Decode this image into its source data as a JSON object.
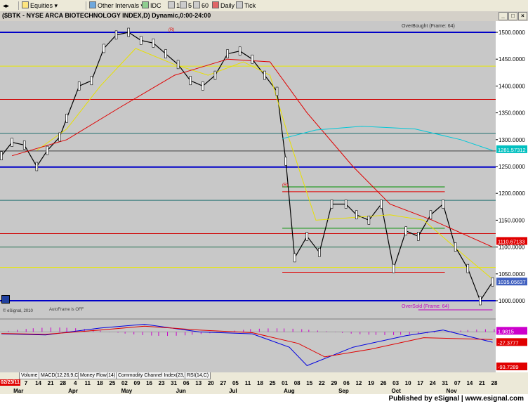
{
  "toolbar": {
    "items": [
      {
        "label": "Equities",
        "icon": "folder-icon"
      },
      {
        "label": "Other Intervals",
        "icon": "clock-icon"
      },
      {
        "label": "IDC",
        "icon": "chart-icon"
      },
      {
        "label": "1",
        "icon": ""
      },
      {
        "label": "5",
        "icon": ""
      },
      {
        "label": "60",
        "icon": ""
      },
      {
        "label": "Daily",
        "icon": "calendar-icon"
      },
      {
        "label": "Tick",
        "icon": "tick-icon"
      }
    ]
  },
  "window": {
    "title": "($BTK - NYSE ARCA BIOTECHNOLOGY INDEX,D) Dynamic,0:00-24:00",
    "minimize": "_",
    "maximize": "□",
    "close": "×"
  },
  "chart_labels": {
    "overbought": "OverBought (Frame: 64)",
    "oversold": "OverSold (Frame: 64)",
    "copyright": "© eSignal, 2010",
    "autoframe": "AutoFrame is OFF",
    "marker_r": "(R)"
  },
  "price_axis": {
    "ticks": [
      "1500.0000",
      "1450.0000",
      "1400.0000",
      "1350.0000",
      "1300.0000",
      "1250.0000",
      "1200.0000",
      "1150.0000",
      "1100.0000",
      "1050.0000",
      "1000.0000"
    ],
    "badges": [
      {
        "value": "1281.57312",
        "color": "#00c0c0"
      },
      {
        "value": "1110.67133",
        "color": "#e00000"
      },
      {
        "value": "1035.05637",
        "color": "#4060c0"
      }
    ]
  },
  "indicator_axis": {
    "badges": [
      {
        "value": "1.9815",
        "color": "#cc00cc"
      },
      {
        "value": "-27.3777",
        "color": "#e00000"
      },
      {
        "value": "-93.7289",
        "color": "#e00000"
      }
    ]
  },
  "tabs": [
    "Volume",
    "MACD(12,26,9,C)",
    "Money Flow(14)",
    "Commodity Channel Index(23,C)",
    "RSI(14,C)"
  ],
  "date_axis": {
    "first_label": "02/23/11",
    "days": [
      "7",
      "14",
      "21",
      "28",
      "4",
      "11",
      "18",
      "25",
      "02",
      "09",
      "16",
      "23",
      "31",
      "06",
      "13",
      "20",
      "27",
      "05",
      "11",
      "18",
      "25",
      "01",
      "08",
      "15",
      "22",
      "29",
      "06",
      "12",
      "19",
      "26",
      "03",
      "10",
      "17",
      "24",
      "31",
      "07",
      "14",
      "21",
      "28"
    ],
    "months": [
      "Mar",
      "Apr",
      "May",
      "Jun",
      "Jul",
      "Aug",
      "Sep",
      "Oct",
      "Nov"
    ]
  },
  "footer": {
    "text": "Published by eSignal | www.esignal.com"
  },
  "chart_data": {
    "type": "line",
    "title": "$BTK - NYSE ARCA BIOTECHNOLOGY INDEX, Daily",
    "ylim": [
      980,
      1520
    ],
    "x_range": [
      "2011-02-23",
      "2011-11-29"
    ],
    "grid": false,
    "horizontal_levels": [
      {
        "value": 1500,
        "color": "#0000c8"
      },
      {
        "value": 1437,
        "color": "#e8e800"
      },
      {
        "value": 1375,
        "color": "#d00000"
      },
      {
        "value": 1312,
        "color": "#207070"
      },
      {
        "value": 1279,
        "color": "#404040"
      },
      {
        "value": 1249,
        "color": "#0000c8"
      },
      {
        "value": 1187,
        "color": "#207070"
      },
      {
        "value": 1125,
        "color": "#d00000"
      },
      {
        "value": 1100,
        "color": "#207050"
      },
      {
        "value": 1062,
        "color": "#e8e800"
      },
      {
        "value": 1000,
        "color": "#0000c8"
      }
    ],
    "segment_levels": [
      {
        "value": 1212,
        "color": "#009000",
        "from": "2011-08-01",
        "to": "2011-11-01"
      },
      {
        "value": 1203,
        "color": "#e00000",
        "from": "2011-08-01",
        "to": "2011-11-01"
      },
      {
        "value": 1135,
        "color": "#009000",
        "from": "2011-08-01",
        "to": "2011-11-01"
      },
      {
        "value": 1053,
        "color": "#e00000",
        "from": "2011-08-01",
        "to": "2011-11-01"
      },
      {
        "value": 983,
        "color": "#c000c0",
        "from": "2011-10-17",
        "to": "2011-11-28"
      }
    ],
    "series": [
      {
        "name": "close",
        "color": "#000000",
        "x": [
          "2011-02-23",
          "2011-03-01",
          "2011-03-08",
          "2011-03-15",
          "2011-03-21",
          "2011-03-28",
          "2011-04-01",
          "2011-04-08",
          "2011-04-15",
          "2011-04-22",
          "2011-04-29",
          "2011-05-06",
          "2011-05-13",
          "2011-05-20",
          "2011-05-27",
          "2011-06-03",
          "2011-06-10",
          "2011-06-17",
          "2011-06-24",
          "2011-07-01",
          "2011-07-08",
          "2011-07-15",
          "2011-07-22",
          "2011-07-29",
          "2011-08-03",
          "2011-08-08",
          "2011-08-15",
          "2011-08-22",
          "2011-08-29",
          "2011-09-06",
          "2011-09-12",
          "2011-09-19",
          "2011-09-26",
          "2011-10-03",
          "2011-10-10",
          "2011-10-17",
          "2011-10-24",
          "2011-10-31",
          "2011-11-07",
          "2011-11-14",
          "2011-11-21",
          "2011-11-28"
        ],
        "values": [
          1270,
          1295,
          1290,
          1250,
          1280,
          1305,
          1340,
          1400,
          1410,
          1470,
          1495,
          1500,
          1485,
          1480,
          1460,
          1440,
          1410,
          1400,
          1420,
          1460,
          1465,
          1450,
          1420,
          1390,
          1260,
          1080,
          1120,
          1090,
          1180,
          1180,
          1160,
          1150,
          1180,
          1060,
          1130,
          1120,
          1160,
          1180,
          1100,
          1060,
          1000,
          1035
        ]
      },
      {
        "name": "ma-yellow",
        "color": "#e8e000",
        "x": [
          "2011-03-15",
          "2011-04-01",
          "2011-04-20",
          "2011-05-10",
          "2011-06-01",
          "2011-06-20",
          "2011-07-10",
          "2011-07-25",
          "2011-08-05",
          "2011-08-20",
          "2011-09-10",
          "2011-10-01",
          "2011-10-20",
          "2011-11-10",
          "2011-11-28"
        ],
        "values": [
          1280,
          1320,
          1400,
          1470,
          1440,
          1420,
          1445,
          1420,
          1300,
          1150,
          1155,
          1160,
          1150,
          1090,
          1040
        ]
      },
      {
        "name": "ma-red",
        "color": "#e00000",
        "x": [
          "2011-03-01",
          "2011-04-01",
          "2011-05-01",
          "2011-06-01",
          "2011-07-01",
          "2011-07-25",
          "2011-08-15",
          "2011-09-10",
          "2011-10-01",
          "2011-10-25",
          "2011-11-28"
        ],
        "values": [
          1270,
          1300,
          1360,
          1420,
          1450,
          1445,
          1350,
          1250,
          1180,
          1150,
          1100
        ]
      },
      {
        "name": "ma-cyan",
        "color": "#00c8d8",
        "x": [
          "2011-08-01",
          "2011-08-20",
          "2011-09-15",
          "2011-10-15",
          "2011-11-10",
          "2011-11-28"
        ],
        "values": [
          1302,
          1318,
          1325,
          1320,
          1300,
          1280
        ]
      }
    ],
    "macd": {
      "ylim": [
        -100,
        30
      ],
      "macd_line": {
        "color": "#0000e0",
        "x": [
          "2011-02-23",
          "2011-03-20",
          "2011-04-20",
          "2011-05-15",
          "2011-06-15",
          "2011-07-15",
          "2011-08-05",
          "2011-08-15",
          "2011-09-10",
          "2011-10-10",
          "2011-10-31",
          "2011-11-28"
        ],
        "values": [
          -5,
          -8,
          10,
          20,
          0,
          -5,
          -40,
          -88,
          -40,
          -10,
          5,
          -27
        ]
      },
      "signal_line": {
        "color": "#e00000",
        "x": [
          "2011-02-23",
          "2011-03-20",
          "2011-04-20",
          "2011-05-15",
          "2011-06-15",
          "2011-07-15",
          "2011-08-10",
          "2011-08-25",
          "2011-09-20",
          "2011-10-20",
          "2011-11-28"
        ],
        "values": [
          -4,
          -6,
          5,
          15,
          5,
          -2,
          -30,
          -65,
          -45,
          -15,
          -20
        ]
      },
      "histogram_color": "#cc00cc"
    }
  }
}
